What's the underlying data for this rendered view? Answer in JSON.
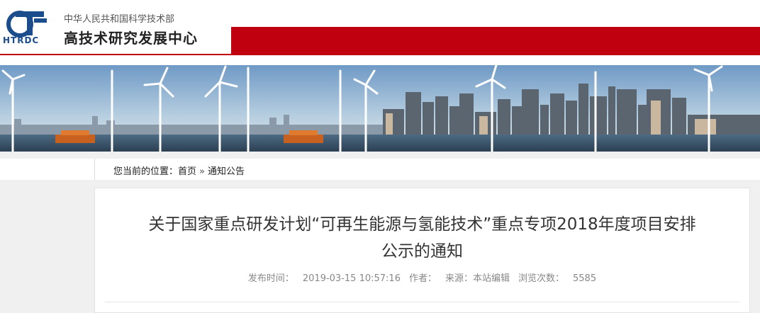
{
  "header": {
    "logo_text": "HTRDC",
    "ministry": "中华人民共和国科学技术部",
    "center_name": "高技术研究发展中心"
  },
  "breadcrumb": {
    "label": "您当前的位置：",
    "home": "首页",
    "separator": "»",
    "current": "通知公告"
  },
  "article": {
    "title_line1": "关于国家重点研发计划“可再生能源与氢能技术”重点专项2018年度项目安排",
    "title_line2": "公示的通知",
    "meta": {
      "publish_label": "发布时间：",
      "publish_time": "2019-03-15 10:57:16",
      "author_label": "作者：",
      "source_label": "来源：本站编辑",
      "views_label": "浏览次数：",
      "views": "5585"
    }
  },
  "colors": {
    "brand_red": "#c1000f",
    "logo_blue": "#1b4c8c"
  }
}
